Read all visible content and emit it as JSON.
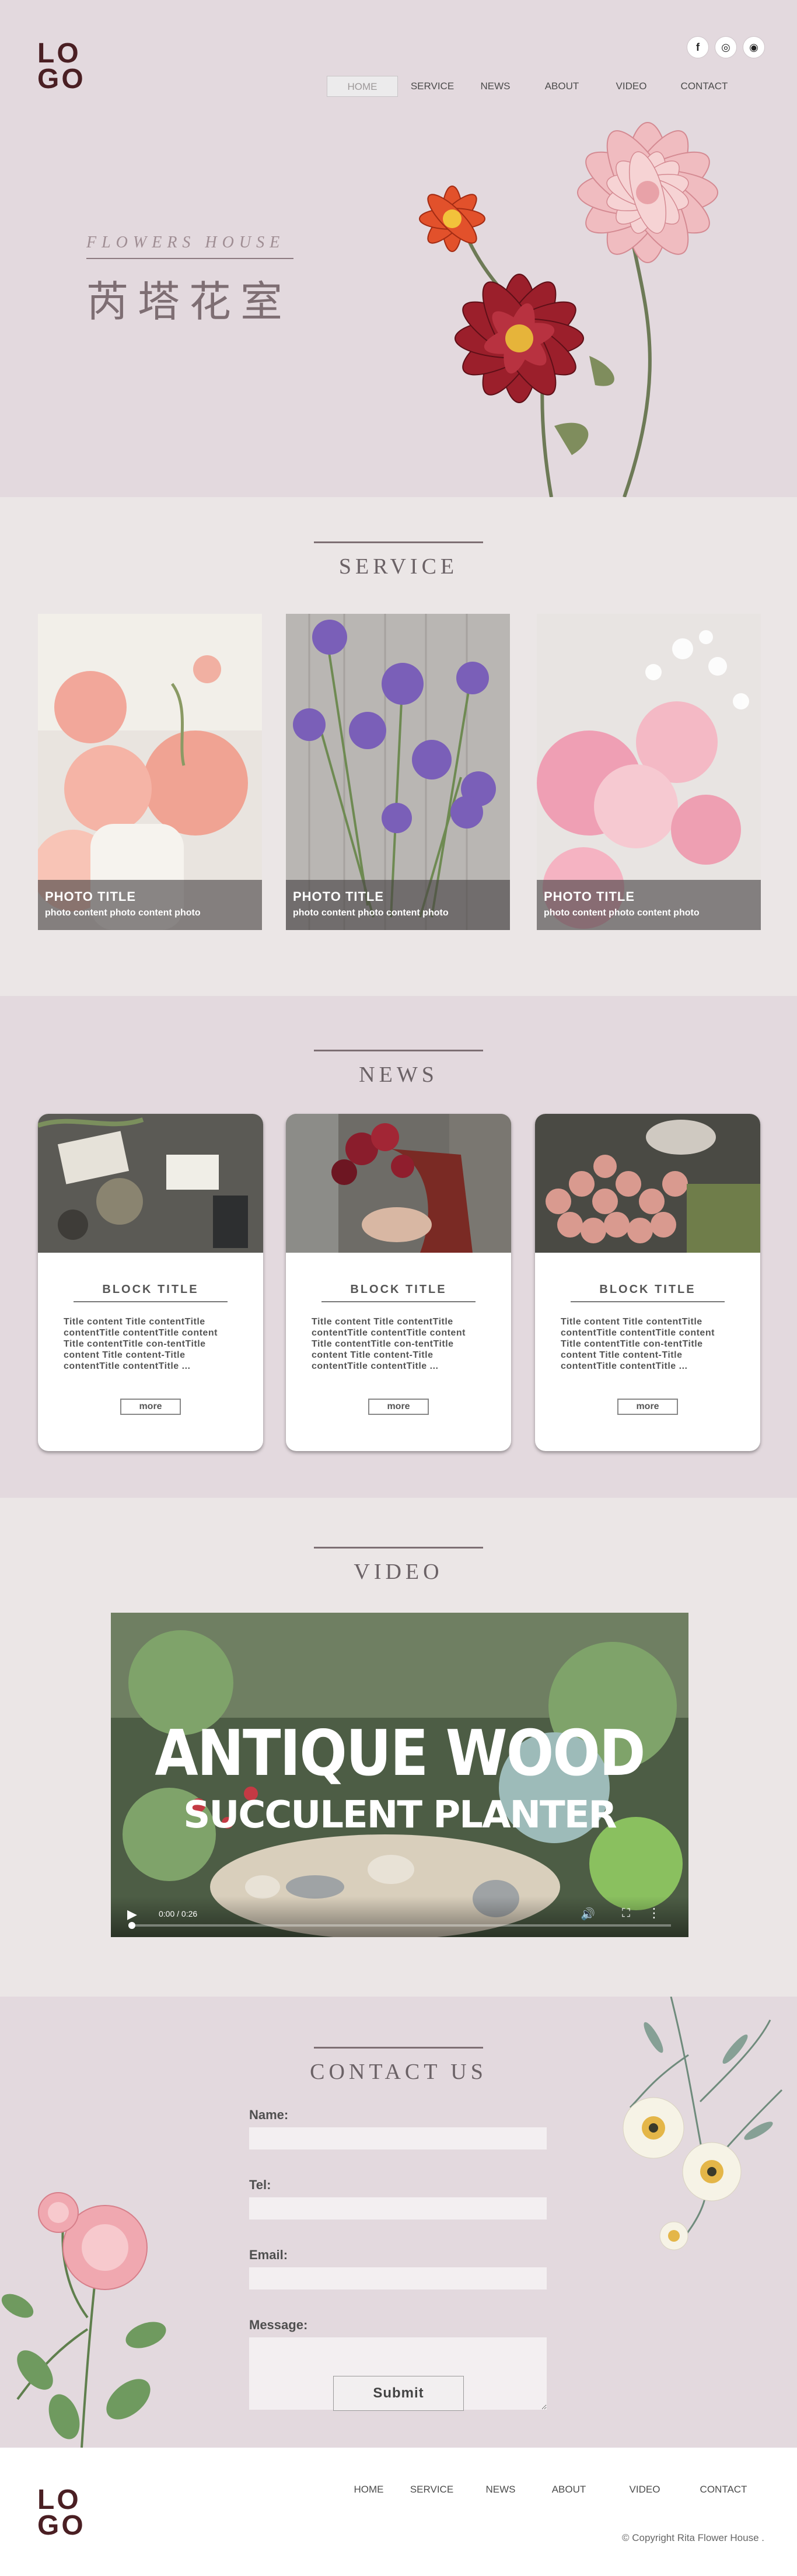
{
  "header": {
    "logo_line1": "LO",
    "logo_line2": "GO",
    "social": [
      "f",
      "◎",
      "◉"
    ],
    "nav": [
      "HOME",
      "SERVICE",
      "NEWS",
      "ABOUT",
      "VIDEO",
      "CONTACT"
    ]
  },
  "hero": {
    "subtitle": "FLOWERS HOUSE",
    "title": "芮塔花室"
  },
  "service": {
    "title": "SERVICE",
    "cards": [
      {
        "title": "PHOTO TITLE",
        "content": "photo content photo content photo"
      },
      {
        "title": "PHOTO TITLE",
        "content": "photo content photo content photo"
      },
      {
        "title": "PHOTO TITLE",
        "content": "photo content photo content photo"
      }
    ]
  },
  "news": {
    "title": "NEWS",
    "cards": [
      {
        "title": "BLOCK TITLE",
        "content": "Title content Title contentTitle contentTitle contentTitle content Title contentTitle con-tentTitle content Title content-Title contentTitle contentTitle ...",
        "button": "more"
      },
      {
        "title": "BLOCK TITLE",
        "content": "Title content Title contentTitle contentTitle contentTitle content Title contentTitle con-tentTitle content Title content-Title contentTitle contentTitle ...",
        "button": "more"
      },
      {
        "title": "BLOCK TITLE",
        "content": "Title content Title contentTitle contentTitle contentTitle content Title contentTitle con-tentTitle content Title content-Title contentTitle contentTitle ...",
        "button": "more"
      }
    ]
  },
  "video": {
    "title": "VIDEO",
    "overlay_line1": "ANTIQUE WOOD",
    "overlay_line2": "SUCCULENT PLANTER",
    "time": "0:00 / 0:26"
  },
  "contact": {
    "title": "CONTACT US",
    "name_label": "Name:",
    "tel_label": "Tel:",
    "email_label": "Email:",
    "message_label": "Message:",
    "submit": "Submit"
  },
  "footer": {
    "logo_line1": "LO",
    "logo_line2": "GO",
    "nav": [
      "HOME",
      "SERVICE",
      "NEWS",
      "ABOUT",
      "VIDEO",
      "CONTACT"
    ],
    "copyright": "© Copyright Rita Flower House ."
  }
}
